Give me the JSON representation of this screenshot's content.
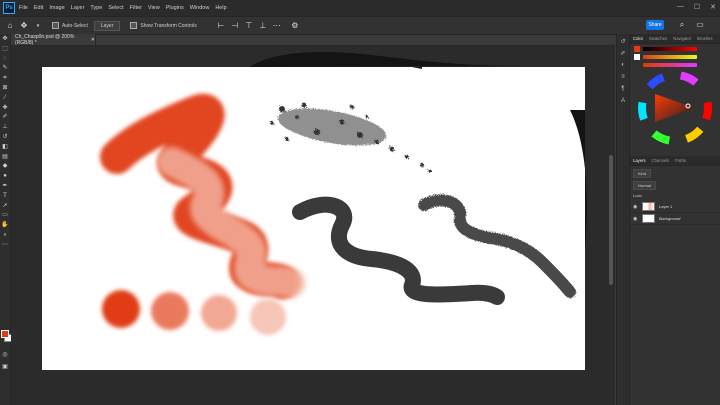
{
  "app": {
    "logo_text": "Ps"
  },
  "menu": [
    "File",
    "Edit",
    "Image",
    "Layer",
    "Type",
    "Select",
    "Filter",
    "View",
    "Plugins",
    "Window",
    "Help"
  ],
  "window_controls": [
    "—",
    "☐",
    "✕"
  ],
  "options_bar": {
    "auto_select_label": "Auto-Select",
    "layer_dropdown": "Layer",
    "transform_label": "Show Transform Controls",
    "share_label": "Share"
  },
  "document": {
    "tab_label": "Ch_Chasp0n.psd @ 200% (RGB/8) *"
  },
  "panels": {
    "color_tabs": [
      "Color",
      "Swatches",
      "Navigator",
      "Brushes"
    ],
    "layers_tabs": [
      "Layers",
      "Channels",
      "Paths"
    ],
    "kind_label": "Kind",
    "normal_label": "Normal",
    "lock_label": "Lock:",
    "layers": [
      {
        "name": "Layer 1"
      },
      {
        "name": "Background"
      }
    ]
  },
  "colors": {
    "accent": "#e03c17",
    "ink": "#333333",
    "share": "#1473e6"
  },
  "icons": {
    "home": "home-icon",
    "move": "move-icon"
  }
}
